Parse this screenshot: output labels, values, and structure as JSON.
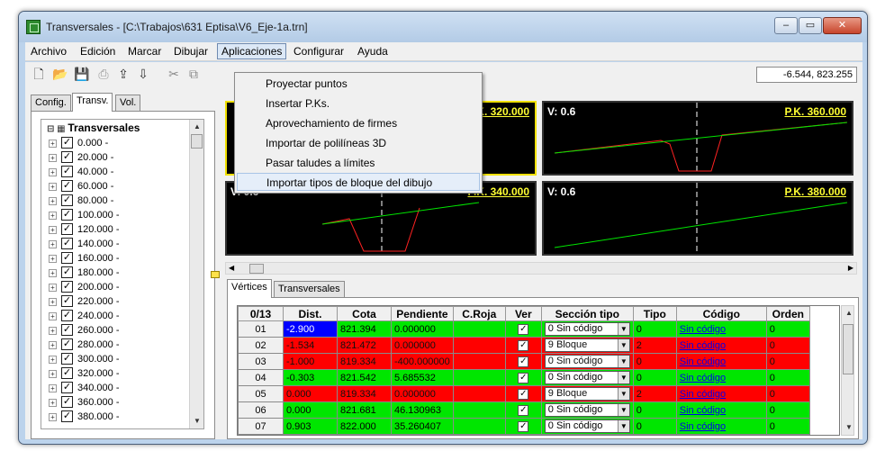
{
  "window": {
    "title": "Transversales - [C:\\Trabajos\\631 Eptisa\\V6_Eje-1a.trn]",
    "min_label": "–",
    "max_label": "▭",
    "close_label": "✕"
  },
  "menu": [
    "Archivo",
    "Edición",
    "Marcar",
    "Dibujar",
    "Aplicaciones",
    "Configurar",
    "Ayuda"
  ],
  "dropdown": [
    "Proyectar puntos",
    "Insertar P.Ks.",
    "Aprovechamiento de firmes",
    "Importar de polilíneas 3D",
    "Pasar taludes a límites",
    "Importar tipos de bloque del dibujo"
  ],
  "toolbar_icons": [
    "new-file-icon",
    "open-folder-icon",
    "save-icon",
    "print-icon",
    "export-icon",
    "import-icon",
    "cut-icon",
    "copy-icon"
  ],
  "coord_readout": "-6.544, 823.255",
  "left_tabs": [
    "Config.",
    "Transv.",
    "Vol."
  ],
  "tree": {
    "root": "Transversales",
    "items": [
      "0.000 -",
      "20.000 -",
      "40.000 -",
      "60.000 -",
      "80.000 -",
      "100.000 -",
      "120.000 -",
      "140.000 -",
      "160.000 -",
      "180.000 -",
      "200.000 -",
      "220.000 -",
      "240.000 -",
      "260.000 -",
      "280.000 -",
      "300.000 -",
      "320.000 -",
      "340.000 -",
      "360.000 -",
      "380.000 -"
    ]
  },
  "views": [
    {
      "v": "",
      "pk": "P.K. 320.000"
    },
    {
      "v": "V: 0.6",
      "pk": "P.K. 360.000"
    },
    {
      "v": "V: 0.6",
      "pk": "P.K. 340.000"
    },
    {
      "v": "V: 0.6",
      "pk": "P.K. 380.000"
    }
  ],
  "bottom_tabs": [
    "Vértices",
    "Transversales"
  ],
  "grid": {
    "headers": [
      "0/13",
      "Dist.",
      "Cota",
      "Pendiente",
      "C.Roja",
      "Ver",
      "Sección tipo",
      "Tipo",
      "Código",
      "Orden"
    ],
    "rows": [
      {
        "idx": "01",
        "dist": "-2.900",
        "cota": "821.394",
        "pend": "0.000000",
        "croja": "",
        "sec": "0  Sin código",
        "tipo": "0",
        "cod": "Sin código",
        "orden": "0",
        "color": "green"
      },
      {
        "idx": "02",
        "dist": "-1.534",
        "cota": "821.472",
        "pend": "0.000000",
        "croja": "",
        "sec": "9  Bloque",
        "tipo": "2",
        "cod": "Sin código",
        "orden": "0",
        "color": "red"
      },
      {
        "idx": "03",
        "dist": "-1.000",
        "cota": "819.334",
        "pend": "-400.000000",
        "croja": "",
        "sec": "0  Sin código",
        "tipo": "0",
        "cod": "Sin código",
        "orden": "0",
        "color": "red"
      },
      {
        "idx": "04",
        "dist": "-0.303",
        "cota": "821.542",
        "pend": "5.685532",
        "croja": "",
        "sec": "0  Sin código",
        "tipo": "0",
        "cod": "Sin código",
        "orden": "0",
        "color": "green"
      },
      {
        "idx": "05",
        "dist": "0.000",
        "cota": "819.334",
        "pend": "0.000000",
        "croja": "",
        "sec": "9  Bloque",
        "tipo": "2",
        "cod": "Sin código",
        "orden": "0",
        "color": "red"
      },
      {
        "idx": "06",
        "dist": "0.000",
        "cota": "821.681",
        "pend": "46.130963",
        "croja": "",
        "sec": "0  Sin código",
        "tipo": "0",
        "cod": "Sin código",
        "orden": "0",
        "color": "green"
      },
      {
        "idx": "07",
        "dist": "0.903",
        "cota": "822.000",
        "pend": "35.260407",
        "croja": "",
        "sec": "0  Sin código",
        "tipo": "0",
        "cod": "Sin código",
        "orden": "0",
        "color": "green"
      }
    ]
  }
}
